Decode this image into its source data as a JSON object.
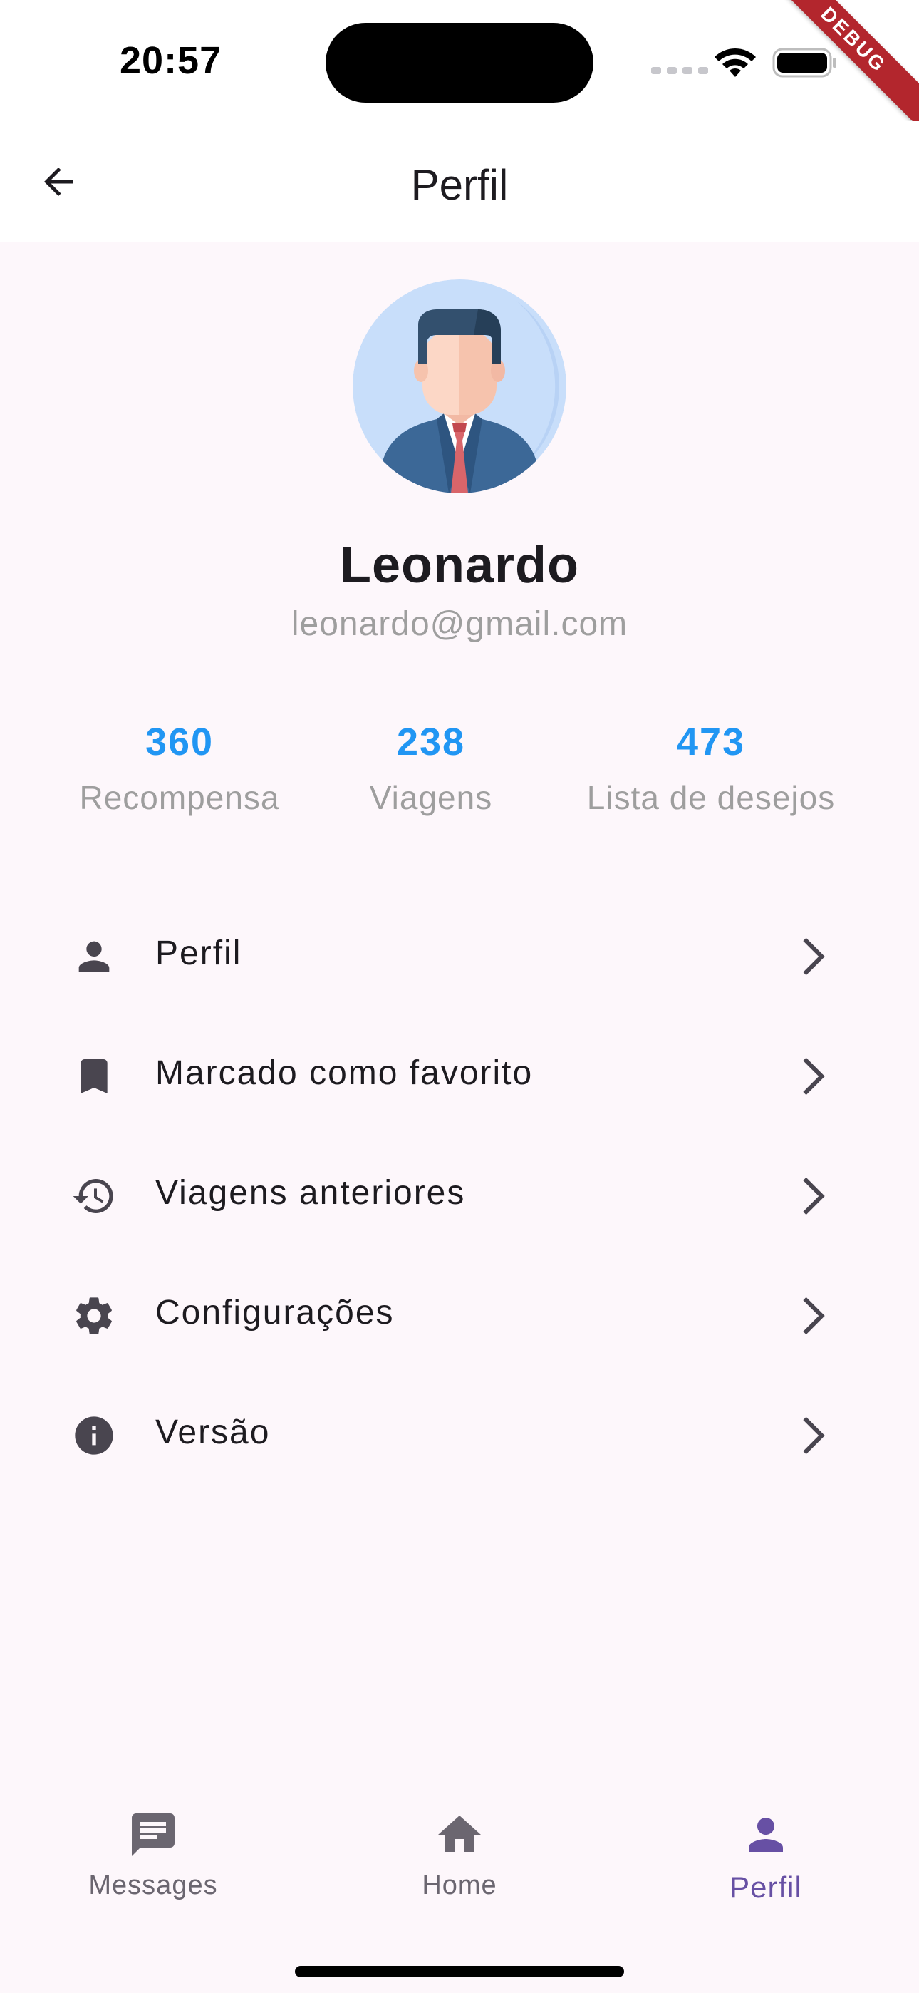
{
  "status_bar": {
    "time": "20:57",
    "debug_banner": "DEBUG"
  },
  "app_bar": {
    "title": "Perfil",
    "back_icon": "arrow-back-icon"
  },
  "profile": {
    "avatar_icon": "businessman-avatar",
    "name": "Leonardo",
    "email": "leonardo@gmail.com"
  },
  "stats": [
    {
      "value": "360",
      "label": "Recompensa"
    },
    {
      "value": "238",
      "label": "Viagens"
    },
    {
      "value": "473",
      "label": "Lista de desejos"
    }
  ],
  "menu": [
    {
      "label": "Perfil",
      "icon": "person-icon"
    },
    {
      "label": "Marcado como favorito",
      "icon": "bookmark-icon"
    },
    {
      "label": "Viagens anteriores",
      "icon": "history-icon"
    },
    {
      "label": "Configurações",
      "icon": "gear-icon"
    },
    {
      "label": "Versão",
      "icon": "info-icon"
    }
  ],
  "bottom_nav": [
    {
      "label": "Messages",
      "icon": "message-icon",
      "active": false
    },
    {
      "label": "Home",
      "icon": "home-icon",
      "active": false
    },
    {
      "label": "Perfil",
      "icon": "person-icon",
      "active": true
    }
  ],
  "colors": {
    "background": "#fdf7fb",
    "stat_value": "#2196f3",
    "muted_text": "#9e9e9e",
    "icon": "#49454f",
    "nav_active": "#6750a4",
    "debug_ribbon": "#b3262d"
  }
}
